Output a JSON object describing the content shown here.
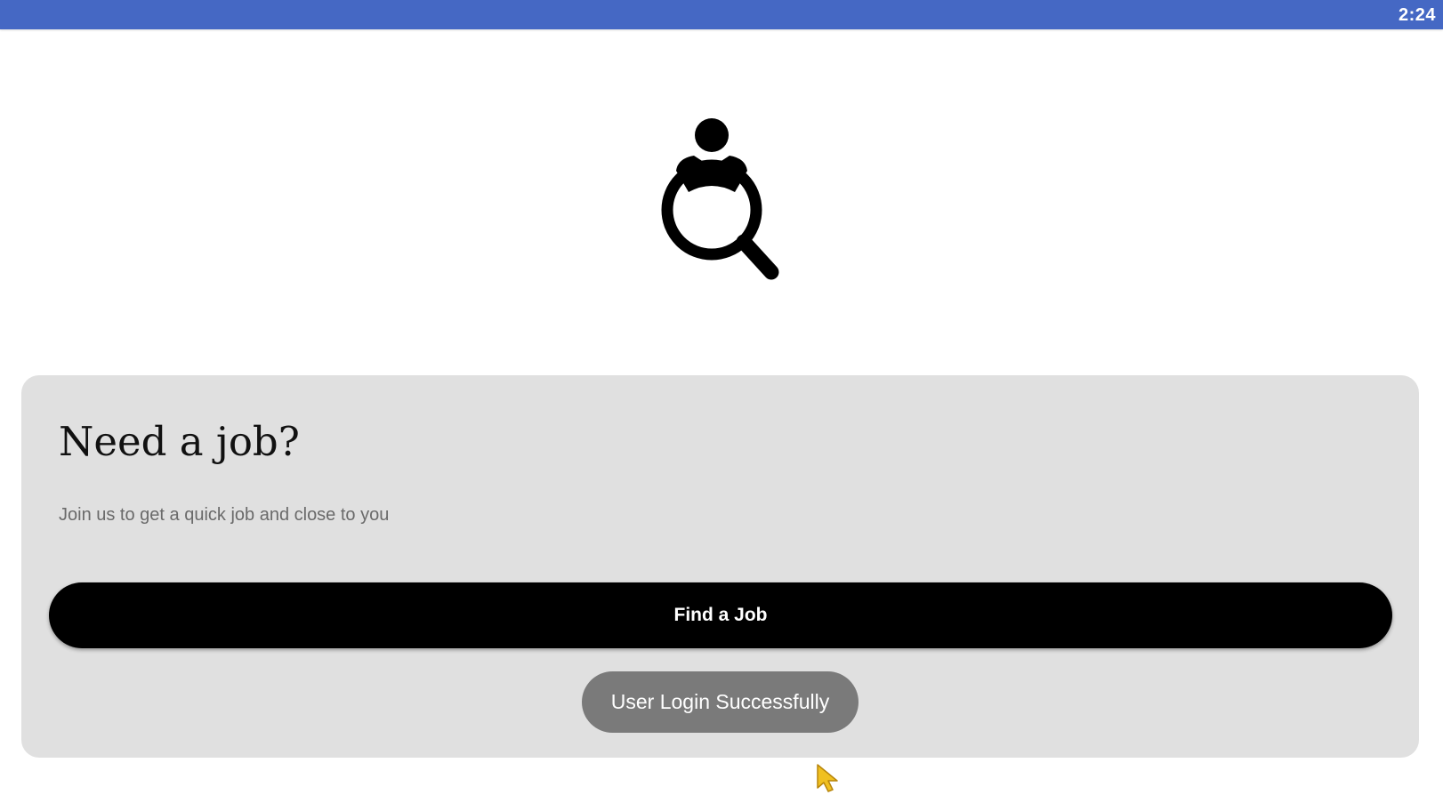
{
  "status_bar": {
    "time": "2:24",
    "color": "#4568c4"
  },
  "logo": {
    "icon": "job-search-person-magnifier-icon"
  },
  "card": {
    "title": "Need a job?",
    "subtitle": "Join us to get a quick job and close to you",
    "background": "#e0e0e0"
  },
  "actions": {
    "find_job_label": "Find a Job"
  },
  "toast": {
    "message": "User Login Successfully"
  },
  "cursor": {
    "icon": "mouse-pointer-icon",
    "color": "#f0c020"
  }
}
